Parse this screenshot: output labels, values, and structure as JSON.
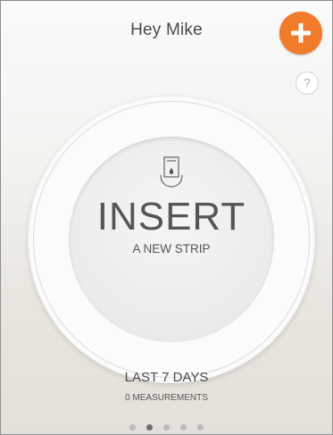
{
  "header": {
    "greeting": "Hey Mike",
    "add_icon": "plus-icon",
    "help_label": "?"
  },
  "insert_prompt": {
    "icon": "test-strip-icon",
    "title": "INSERT",
    "subtitle": "A NEW STRIP"
  },
  "summary": {
    "period_label": "LAST 7 DAYS",
    "measurements_label": "0 MEASUREMENTS"
  },
  "pagination": {
    "total_pages": 5,
    "active_page": 2
  },
  "colors": {
    "accent": "#f07b2a",
    "text": "#4a4a4a",
    "dot_inactive": "#b9b9b9",
    "dot_active": "#6f6f6f"
  }
}
